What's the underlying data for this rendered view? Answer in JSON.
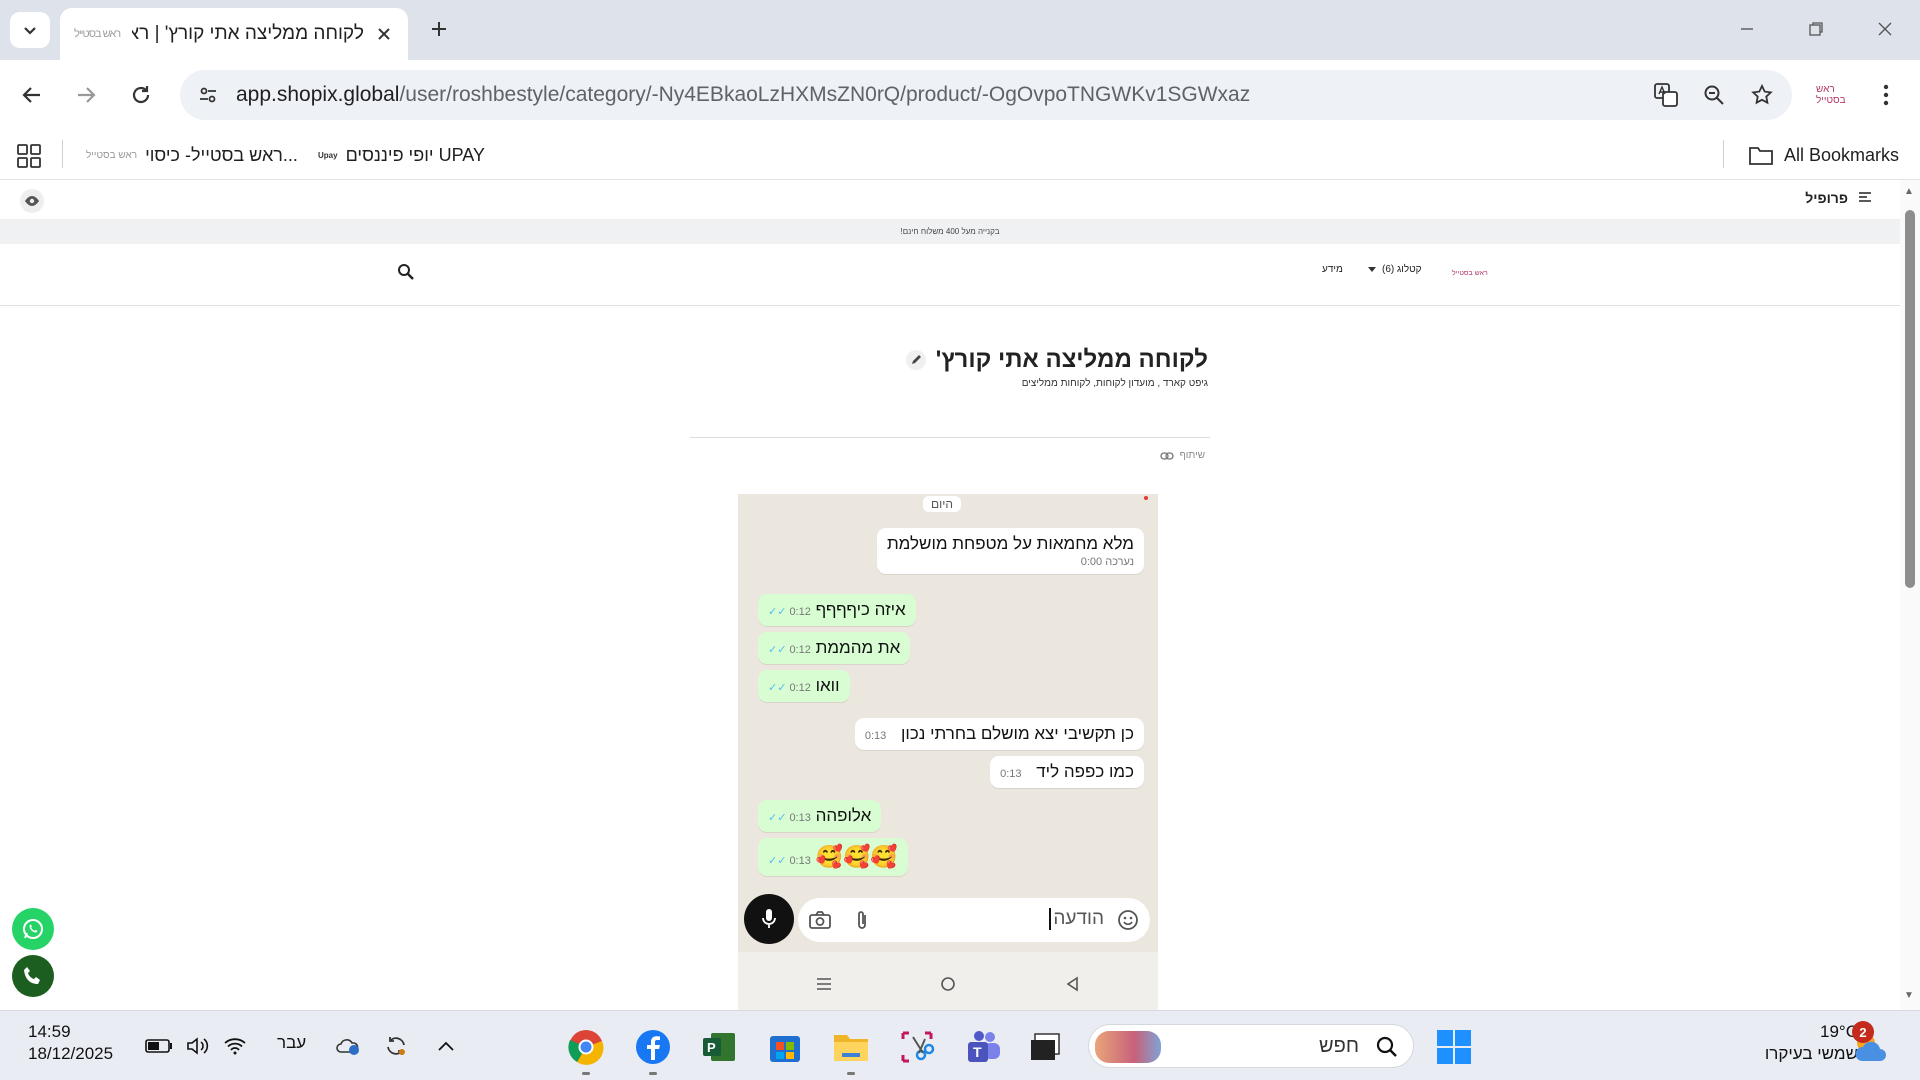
{
  "browser": {
    "tab": {
      "title": "לקוחה ממליצה אתי קורץ' | ראש",
      "favicon": "ראש בסטייל"
    },
    "address": {
      "host": "app.shopix.global",
      "path": "/user/roshbestyle/category/-Ny4EBkaoLzHXMsZN0rQ/product/-OgOvpoTNGWKv1SGWxaz"
    },
    "bookmarks": [
      {
        "label": "ראש בסטייל- כיסוי...",
        "favicon": "ראש בסטייל"
      },
      {
        "label": "יופי פיננסים UPAY",
        "favicon": "Upay"
      }
    ],
    "all_bookmarks": "All Bookmarks",
    "profile_logo": "ראש בסטייל"
  },
  "site": {
    "admin": {
      "profile_label": "פרופיל"
    },
    "announcement": "בקנייה מעל 400 משלוח חינם!",
    "nav": {
      "catalog": "קטלוג (6)",
      "info": "מידע",
      "logo": "ראש בסטייל"
    },
    "product": {
      "title": "לקוחה ממליצה אתי קורץ'",
      "categories": "גיפט קארד , מועדון לקוחות, לקוחות ממליצים",
      "share": "שיתוף"
    }
  },
  "chat": {
    "day_label": "היום",
    "messages": [
      {
        "text": "מלא מחמאות על מטפחת מושלמת",
        "time": "0:00",
        "note": "נערכה",
        "dir": "in"
      },
      {
        "text": "איזה כיףףףף",
        "time": "0:12",
        "dir": "out"
      },
      {
        "text": "את מהממת",
        "time": "0:12",
        "dir": "out"
      },
      {
        "text": "וואו",
        "time": "0:12",
        "dir": "out"
      },
      {
        "text": "כן תקשיבי יצא מושלם בחרתי נכון",
        "time": "0:13",
        "dir": "in"
      },
      {
        "text": "כמו כפפה ליד",
        "time": "0:13",
        "dir": "in"
      },
      {
        "text": "אלופהה",
        "time": "0:13",
        "dir": "out"
      },
      {
        "text": "🥰🥰🥰",
        "time": "0:13",
        "dir": "out"
      }
    ],
    "composer_placeholder": "הודעה"
  },
  "taskbar": {
    "time": "14:59",
    "date": "18/12/2025",
    "language": "עבר",
    "search_placeholder": "חפש",
    "weather_temp": "19°C",
    "weather_desc": "שמשי בעיקרו",
    "notification_count": "2"
  }
}
